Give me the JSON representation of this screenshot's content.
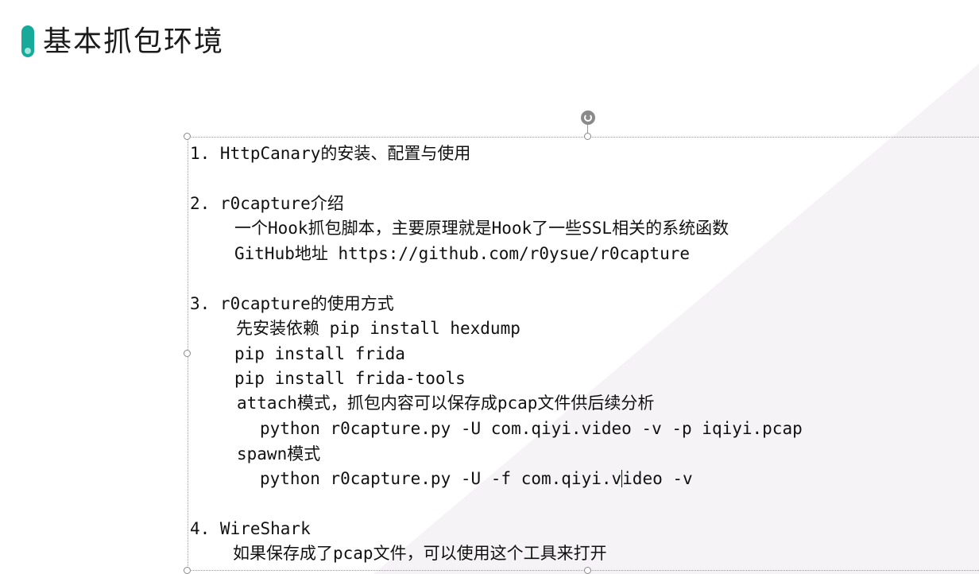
{
  "slide": {
    "title": "基本抓包环境"
  },
  "content": {
    "lines": [
      "1. HttpCanary的安装、配置与使用",
      "2. r0capture介绍",
      "一个Hook抓包脚本，主要原理就是Hook了一些SSL相关的系统函数",
      "GitHub地址 https://github.com/r0ysue/r0capture",
      "3. r0capture的使用方式",
      "先安装依赖 pip install hexdump",
      "pip install frida",
      "pip install frida-tools",
      "attach模式，抓包内容可以保存成pcap文件供后续分析",
      "python r0capture.py -U com.qiyi.video -v -p iqiyi.pcap",
      "spawn模式",
      "python r0capture.py -U -f com.qiyi.v",
      "ideo -v",
      "4. WireShark",
      "如果保存成了pcap文件，可以使用这个工具来打开"
    ]
  }
}
